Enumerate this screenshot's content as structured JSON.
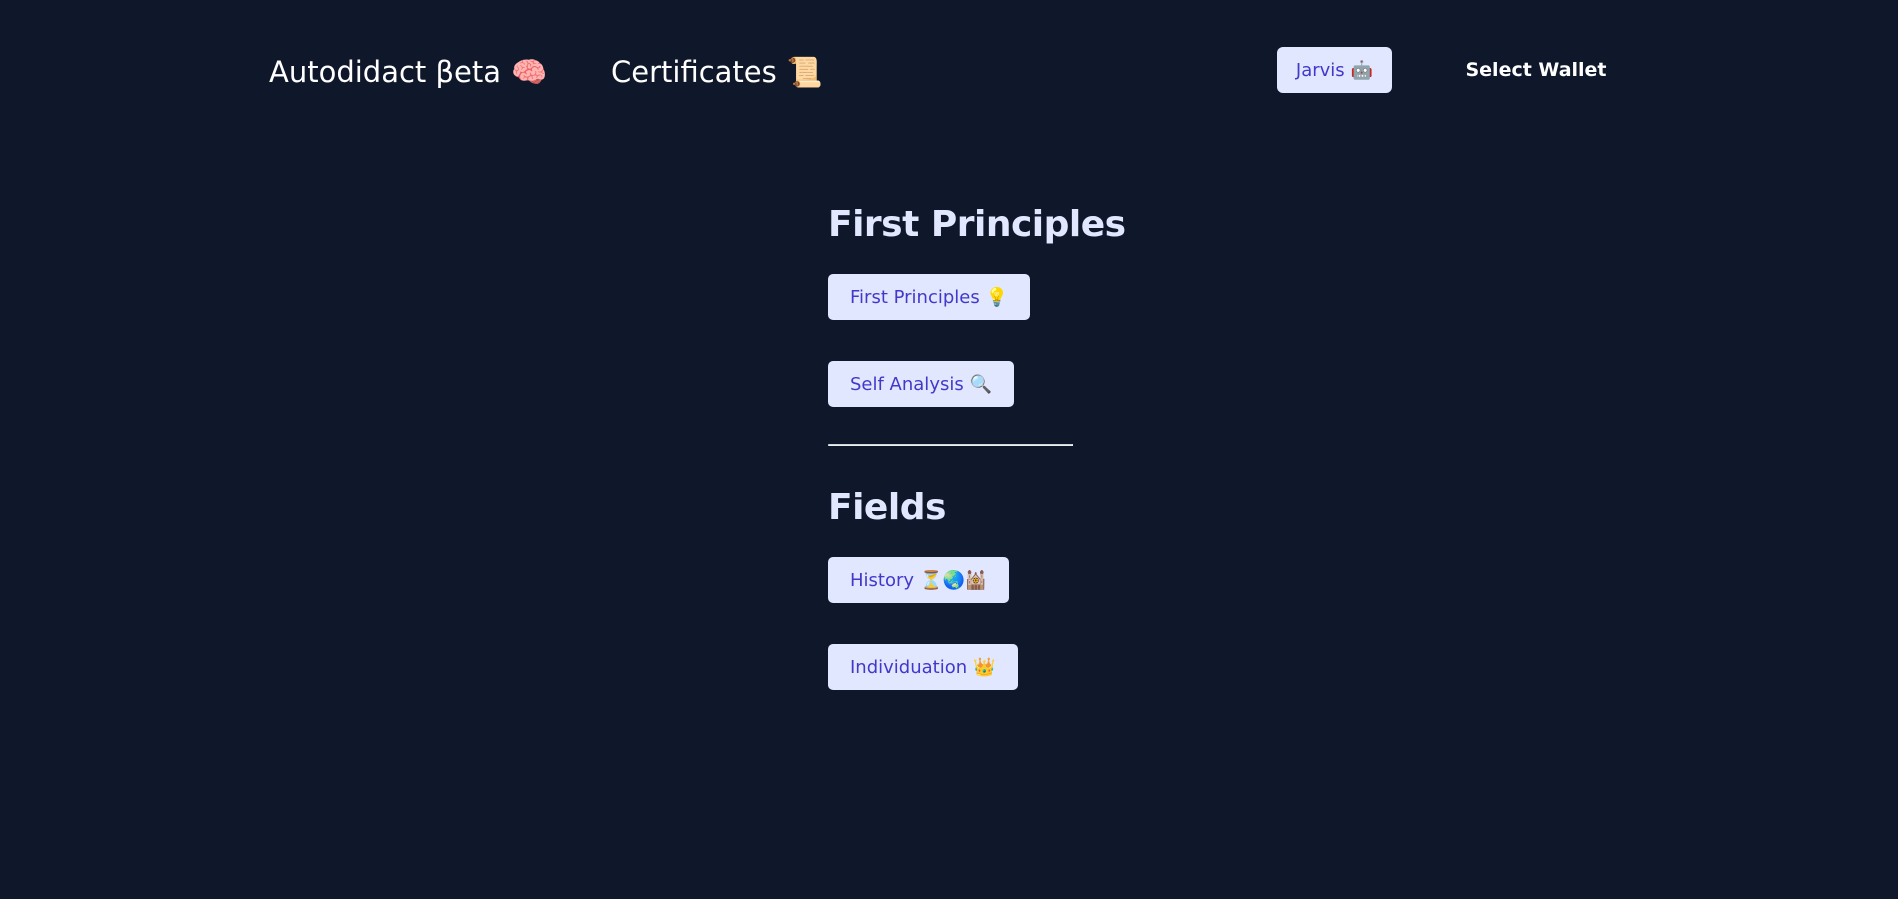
{
  "nav": {
    "brand_label": "Autodidact βeta",
    "brand_emoji": "🧠",
    "certificates_label": "Certificates",
    "certificates_emoji": "📜",
    "jarvis_label": "Jarvis",
    "jarvis_emoji": "🤖",
    "wallet_label": "Select Wallet"
  },
  "sections": [
    {
      "title": "First Principles",
      "items": [
        {
          "label": "First Principles",
          "emoji": "💡"
        },
        {
          "label": "Self Analysis",
          "emoji": "🔍"
        }
      ]
    },
    {
      "title": "Fields",
      "items": [
        {
          "label": "History",
          "emoji": "⏳🌏🕍"
        },
        {
          "label": "Individuation",
          "emoji": "👑"
        }
      ]
    }
  ],
  "colors": {
    "background": "#0f172a",
    "pill_bg": "#e0e7ff",
    "pill_text": "#4338ca",
    "heading": "#e0e7ff"
  }
}
